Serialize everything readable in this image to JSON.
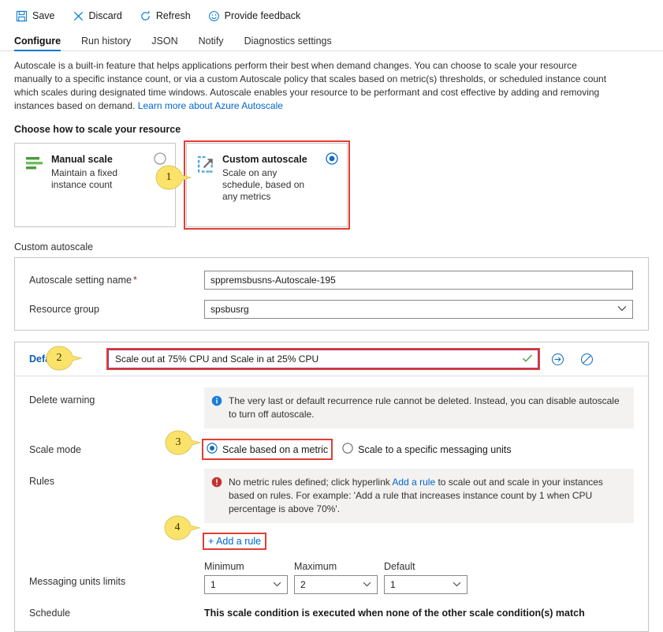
{
  "toolbar": {
    "items": [
      {
        "label": "Save",
        "icon": "save-icon"
      },
      {
        "label": "Discard",
        "icon": "close-x-icon"
      },
      {
        "label": "Refresh",
        "icon": "refresh-icon"
      },
      {
        "label": "Provide feedback",
        "icon": "smiley-icon"
      }
    ]
  },
  "tabs": [
    {
      "label": "Configure",
      "active": true
    },
    {
      "label": "Run history",
      "active": false
    },
    {
      "label": "JSON",
      "active": false
    },
    {
      "label": "Notify",
      "active": false
    },
    {
      "label": "Diagnostics settings",
      "active": false
    }
  ],
  "description": {
    "body": "Autoscale is a built-in feature that helps applications perform their best when demand changes. You can choose to scale your resource manually to a specific instance count, or via a custom Autoscale policy that scales based on metric(s) thresholds, or scheduled instance count which scales during designated time windows. Autoscale enables your resource to be performant and cost effective by adding and removing instances based on demand.",
    "link": "Learn more about Azure Autoscale"
  },
  "choose_heading": "Choose how to scale your resource",
  "scale_options": [
    {
      "title": "Manual scale",
      "subtitle": "Maintain a fixed instance count",
      "icon": "manual-scale-bars-icon",
      "selected": false
    },
    {
      "title": "Custom autoscale",
      "subtitle": "Scale on any schedule, based on any metrics",
      "icon": "custom-autoscale-arrow-icon",
      "selected": true
    }
  ],
  "custom_autoscale": {
    "panel_label": "Custom autoscale",
    "setting_name": {
      "label": "Autoscale setting name",
      "required_marker": "*",
      "value": "sppremsbusns-Autoscale-195"
    },
    "resource_group": {
      "label": "Resource group",
      "value": "spsbusrg"
    }
  },
  "default_rule": {
    "header_label": "Default",
    "name_value": "Scale out at 75% CPU and Scale in at 25% CPU",
    "valid_icon": "checkmark-icon",
    "move_icon": "move-right-circle-icon",
    "disabled_icon": "no-entry-circle-icon",
    "delete_warning": {
      "label": "Delete warning",
      "icon": "info-icon",
      "text": "The very last or default recurrence rule cannot be deleted. Instead, you can disable autoscale to turn off autoscale."
    },
    "scale_mode": {
      "label": "Scale mode",
      "options": [
        {
          "label": "Scale based on a metric",
          "selected": true
        },
        {
          "label": "Scale to a specific messaging units",
          "selected": false
        }
      ]
    },
    "rules": {
      "label": "Rules",
      "icon": "error-icon",
      "text_part1": "No metric rules defined; click hyperlink ",
      "text_link": "Add a rule",
      "text_part2": " to scale out and scale in your instances based on rules. For example: 'Add a rule that increases instance count by 1 when CPU percentage is above 70%'.",
      "add_rule_label": "+ Add a rule"
    },
    "limits": {
      "label": "Messaging units limits",
      "columns": [
        {
          "header": "Minimum",
          "value": "1"
        },
        {
          "header": "Maximum",
          "value": "2"
        },
        {
          "header": "Default",
          "value": "1"
        }
      ]
    },
    "schedule": {
      "label": "Schedule",
      "text": "This scale condition is executed when none of the other scale condition(s) match"
    }
  },
  "callouts": [
    {
      "number": "1"
    },
    {
      "number": "2"
    },
    {
      "number": "3"
    },
    {
      "number": "4"
    }
  ],
  "colors": {
    "accent": "#0078d4",
    "link": "#0066cc",
    "highlight_box": "#e03e35",
    "callout_fill": "#fbe26a",
    "error": "#a80000",
    "rule_input_border": "#8b3b8b",
    "default_label": "#0f5db3"
  }
}
